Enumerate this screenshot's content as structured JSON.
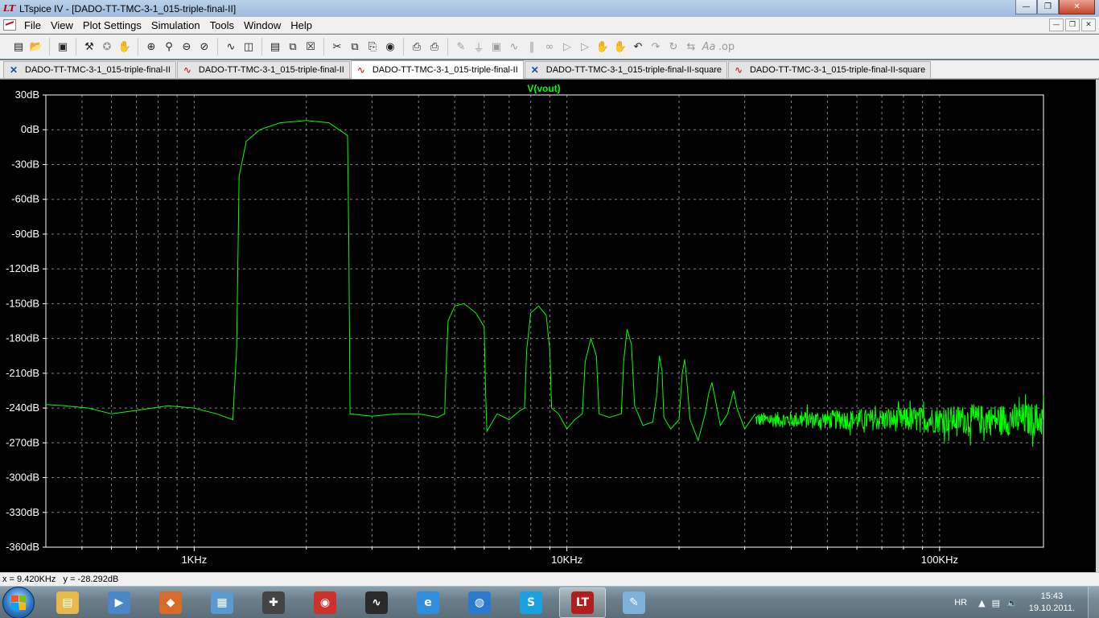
{
  "window": {
    "app_logo": "LT",
    "title": "LTspice IV - [DADO-TT-TMC-3-1_015-triple-final-II]"
  },
  "menu": [
    "File",
    "View",
    "Plot Settings",
    "Simulation",
    "Tools",
    "Window",
    "Help"
  ],
  "toolbar_icons": [
    "new-schematic-icon",
    "open-icon",
    "save-icon",
    "control-panel-icon",
    "run-icon",
    "halt-icon",
    "zoom-in-icon",
    "zoom-pan-icon",
    "zoom-out-icon",
    "zoom-cancel-icon",
    "autorange-icon",
    "tile-vertical-icon",
    "tile-horizontal-icon",
    "cascade-icon",
    "close-window-icon",
    "cut-icon",
    "copy-icon",
    "paste-icon",
    "find-icon",
    "print-setup-icon",
    "print-icon",
    "draw-wire-icon",
    "ground-icon",
    "label-net-icon",
    "resistor-icon",
    "capacitor-icon",
    "inductor-icon",
    "diode-icon",
    "component-icon",
    "move-icon",
    "drag-icon",
    "undo-icon",
    "redo-icon",
    "rotate-icon",
    "mirror-icon",
    "text-icon",
    "spice-directive-icon"
  ],
  "tabs": [
    {
      "label": "DADO-TT-TMC-3-1_015-triple-final-II",
      "type": "schematic",
      "active": false
    },
    {
      "label": "DADO-TT-TMC-3-1_015-triple-final-II",
      "type": "plot",
      "active": false
    },
    {
      "label": "DADO-TT-TMC-3-1_015-triple-final-II",
      "type": "plot",
      "active": true
    },
    {
      "label": "DADO-TT-TMC-3-1_015-triple-final-II-square",
      "type": "schematic",
      "active": false
    },
    {
      "label": "DADO-TT-TMC-3-1_015-triple-final-II-square",
      "type": "plot",
      "active": false
    }
  ],
  "chart_data": {
    "type": "line",
    "title": "V(vout)",
    "x_scale": "log",
    "xlim": [
      400,
      190000
    ],
    "x_ticks": [
      {
        "value": 1000,
        "label": "1KHz"
      },
      {
        "value": 10000,
        "label": "10KHz"
      },
      {
        "value": 100000,
        "label": "100KHz"
      }
    ],
    "ylim": [
      -360,
      30
    ],
    "y_ticks": [
      "30dB",
      "0dB",
      "-30dB",
      "-60dB",
      "-90dB",
      "-120dB",
      "-150dB",
      "-180dB",
      "-210dB",
      "-240dB",
      "-270dB",
      "-300dB",
      "-330dB",
      "-360dB"
    ],
    "y_tick_values": [
      30,
      0,
      -30,
      -60,
      -90,
      -120,
      -150,
      -180,
      -210,
      -240,
      -270,
      -300,
      -330,
      -360
    ],
    "grid": true,
    "colors": {
      "background": "#000000",
      "trace": "#00ff00",
      "grid": "#808080",
      "axis_text": "#ffffff"
    },
    "series": [
      {
        "name": "V(vout)",
        "color": "#00ff00",
        "points": [
          [
            400,
            -237
          ],
          [
            450,
            -238
          ],
          [
            520,
            -240
          ],
          [
            600,
            -245
          ],
          [
            700,
            -242
          ],
          [
            850,
            -238
          ],
          [
            1000,
            -240
          ],
          [
            1150,
            -245
          ],
          [
            1270,
            -250
          ],
          [
            1300,
            -190
          ],
          [
            1320,
            -40
          ],
          [
            1380,
            -10
          ],
          [
            1500,
            0
          ],
          [
            1700,
            6
          ],
          [
            2000,
            8
          ],
          [
            2300,
            6
          ],
          [
            2580,
            -5
          ],
          [
            2600,
            -100
          ],
          [
            2620,
            -245
          ],
          [
            3000,
            -247
          ],
          [
            3500,
            -245
          ],
          [
            4000,
            -245
          ],
          [
            4500,
            -248
          ],
          [
            4700,
            -245
          ],
          [
            4750,
            -200
          ],
          [
            4800,
            -165
          ],
          [
            5000,
            -152
          ],
          [
            5300,
            -150
          ],
          [
            5700,
            -158
          ],
          [
            6000,
            -170
          ],
          [
            6050,
            -225
          ],
          [
            6100,
            -260
          ],
          [
            6500,
            -245
          ],
          [
            7000,
            -250
          ],
          [
            7500,
            -242
          ],
          [
            7700,
            -240
          ],
          [
            7800,
            -190
          ],
          [
            8000,
            -158
          ],
          [
            8400,
            -152
          ],
          [
            8800,
            -160
          ],
          [
            9000,
            -190
          ],
          [
            9100,
            -240
          ],
          [
            9500,
            -245
          ],
          [
            10000,
            -258
          ],
          [
            10500,
            -250
          ],
          [
            11000,
            -245
          ],
          [
            11200,
            -200
          ],
          [
            11600,
            -180
          ],
          [
            12000,
            -195
          ],
          [
            12200,
            -245
          ],
          [
            13000,
            -248
          ],
          [
            14000,
            -245
          ],
          [
            14200,
            -200
          ],
          [
            14500,
            -172
          ],
          [
            14900,
            -185
          ],
          [
            15200,
            -238
          ],
          [
            16000,
            -255
          ],
          [
            17000,
            -252
          ],
          [
            17400,
            -230
          ],
          [
            17700,
            -195
          ],
          [
            18000,
            -208
          ],
          [
            18200,
            -248
          ],
          [
            19000,
            -258
          ],
          [
            20000,
            -250
          ],
          [
            20400,
            -210
          ],
          [
            20700,
            -198
          ],
          [
            21000,
            -218
          ],
          [
            21400,
            -250
          ],
          [
            22500,
            -268
          ],
          [
            23500,
            -245
          ],
          [
            24000,
            -228
          ],
          [
            24500,
            -218
          ],
          [
            25000,
            -232
          ],
          [
            25800,
            -255
          ],
          [
            27000,
            -245
          ],
          [
            28000,
            -225
          ],
          [
            28600,
            -240
          ],
          [
            30000,
            -258
          ],
          [
            32000,
            -245
          ]
        ],
        "noise_floor": {
          "from_hz": 32000,
          "to_hz": 190000,
          "center_db_start": -250,
          "center_db_end": -250,
          "spread_db_start": 12,
          "spread_db_end": 30
        }
      }
    ]
  },
  "status": {
    "cursor_readout": "x = 9.420KHz   y = -28.292dB"
  },
  "taskbar": {
    "items": [
      {
        "name": "explorer-icon",
        "color": "#e7b84a",
        "glyph": "▤"
      },
      {
        "name": "media-player-icon",
        "color": "#4a86c8",
        "glyph": "▶"
      },
      {
        "name": "installer-icon",
        "color": "#d86a2a",
        "glyph": "◆"
      },
      {
        "name": "control-panel-icon",
        "color": "#5a9ad0",
        "glyph": "▦"
      },
      {
        "name": "joystick-icon",
        "color": "#444444",
        "glyph": "✚"
      },
      {
        "name": "security-app-icon",
        "color": "#d0302a",
        "glyph": "◉"
      },
      {
        "name": "oscilloscope-icon",
        "color": "#2a2a2a",
        "glyph": "∿"
      },
      {
        "name": "internet-explorer-icon",
        "color": "#2f8de0",
        "glyph": "e"
      },
      {
        "name": "browser-icon",
        "color": "#2a7ad0",
        "glyph": "◍"
      },
      {
        "name": "skype-icon",
        "color": "#1aa2e0",
        "glyph": "S"
      },
      {
        "name": "ltspice-icon",
        "color": "#b01e1e",
        "glyph": "LT",
        "active": true
      },
      {
        "name": "notepad-icon",
        "color": "#7fb2d8",
        "glyph": "✎"
      }
    ],
    "language": "HR",
    "time": "15:43",
    "date": "19.10.2011."
  }
}
